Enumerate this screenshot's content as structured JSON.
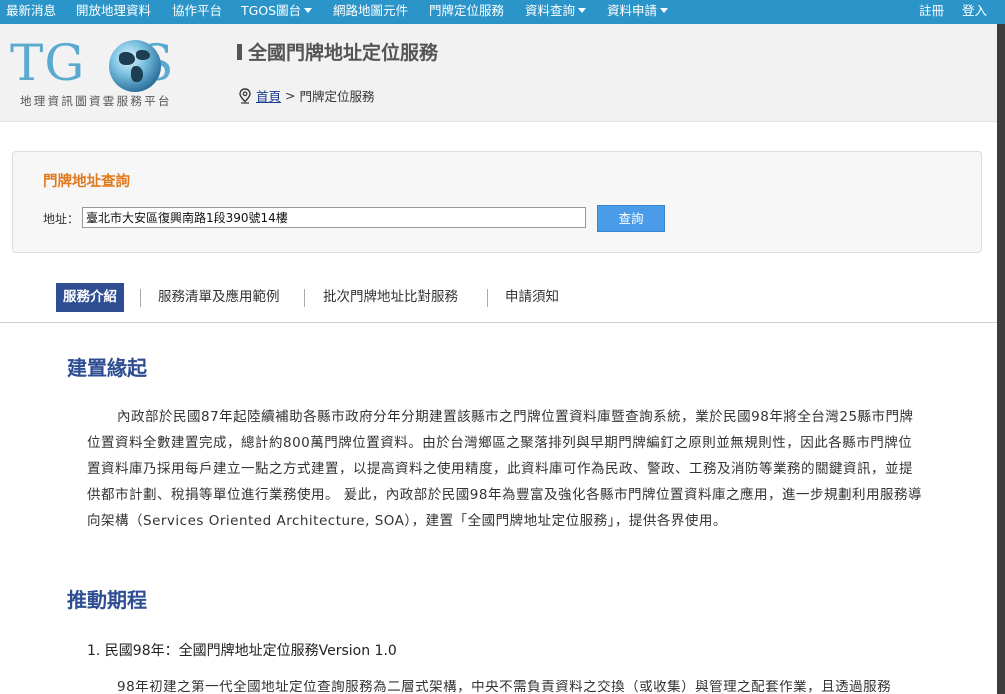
{
  "topnav": {
    "items": [
      {
        "label": "最新消息"
      },
      {
        "label": "開放地理資料"
      },
      {
        "label": "協作平台"
      },
      {
        "label": "TGOS圖台"
      },
      {
        "label": "網路地圖元件"
      },
      {
        "label": "門牌定位服務"
      },
      {
        "label": "資料查詢"
      },
      {
        "label": "資料申請"
      }
    ],
    "register": "註冊",
    "login": "登入",
    "bar_color": "#2b95c9"
  },
  "header": {
    "logo_letters_left": "TG",
    "logo_letters_right": "S",
    "logo_subtitle": "地理資訊圖資雲服務平台",
    "page_title": "全國門牌地址定位服務",
    "breadcrumb": {
      "home": "首頁",
      "separator": ">",
      "current": "門牌定位服務"
    }
  },
  "query": {
    "title": "門牌地址查詢",
    "label": "地址：",
    "value": "臺北市大安區復興南路1段390號14樓",
    "button": "查詢"
  },
  "tabs": [
    {
      "label": "服務介紹",
      "active": true
    },
    {
      "label": "服務清單及應用範例",
      "active": false
    },
    {
      "label": "批次門牌地址比對服務",
      "active": false
    },
    {
      "label": "申請須知",
      "active": false
    }
  ],
  "content": {
    "section1_title": "建置緣起",
    "section1_text": "內政部於民國87年起陸續補助各縣市政府分年分期建置該縣市之門牌位置資料庫暨查詢系統，業於民國98年將全台灣25縣市門牌位置資料全數建置完成，總計約800萬門牌位置資料。由於台灣鄉區之聚落排列與早期門牌編釘之原則並無規則性，因此各縣市門牌位置資料庫乃採用每戶建立一點之方式建置，以提高資料之使用精度，此資料庫可作為民政、警政、工務及消防等業務的關鍵資訊，並提供都市計劃、稅捐等單位進行業務使用。 爰此，內政部於民國98年為豐富及強化各縣市門牌位置資料庫之應用，進一步規劃利用服務導向架構（Services Oriented Architecture, SOA），建置「全國門牌地址定位服務」，提供各界使用。",
    "section2_title": "推動期程",
    "item1_title": "1. 民國98年：全國門牌地址定位服務Version 1.0",
    "item1_text": "98年初建之第一代全國地址定位查詢服務為二層式架構，中央不需負責資料之交換（或收集）與管理之配套作業，且透過服務"
  },
  "colors": {
    "accent": "#2e4d93",
    "query_title": "#e07a1f",
    "button": "#4a9be8"
  }
}
